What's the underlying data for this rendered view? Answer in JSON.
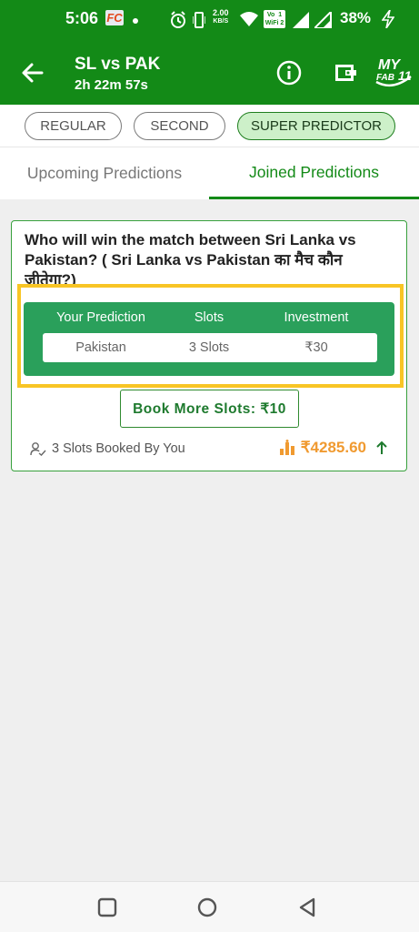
{
  "status_bar": {
    "time": "5:06",
    "fc_badge": "FC",
    "net_speed": "2.00",
    "net_unit": "KB/S",
    "volte_label": "Vo  1 WiFi 2",
    "battery": "38%"
  },
  "header": {
    "title": "SL vs PAK",
    "countdown": "2h 22m 57s",
    "logo_text": "MY FAB 11"
  },
  "predictor_types": [
    {
      "label": "REGULAR",
      "active": false
    },
    {
      "label": "SECOND",
      "active": false
    },
    {
      "label": "SUPER PREDICTOR",
      "active": true
    }
  ],
  "tabs": {
    "upcoming": "Upcoming Predictions",
    "joined": "Joined Predictions",
    "active": "joined"
  },
  "card": {
    "question": "Who will win the match between Sri Lanka vs Pakistan? ( Sri Lanka vs Pakistan का मैच कौन जीतेगा?)",
    "columns": [
      "Your Prediction",
      "Slots",
      "Investment"
    ],
    "row": {
      "prediction": "Pakistan",
      "slots": "3 Slots",
      "investment": "₹30"
    },
    "book_button": "Book More Slots: ₹10",
    "booked_text": "3 Slots Booked By You",
    "pool_amount": "₹4285.60"
  },
  "colors": {
    "brand_green": "#138a17",
    "prediction_green": "#2aa05b",
    "highlight_yellow": "#f8c525",
    "pool_orange": "#f09a30"
  },
  "icons": [
    "back-arrow-icon",
    "info-icon",
    "wallet-icon",
    "user-check-icon",
    "bar-chart-icon",
    "arrow-up-icon",
    "square-icon",
    "circle-icon",
    "triangle-back-icon"
  ]
}
